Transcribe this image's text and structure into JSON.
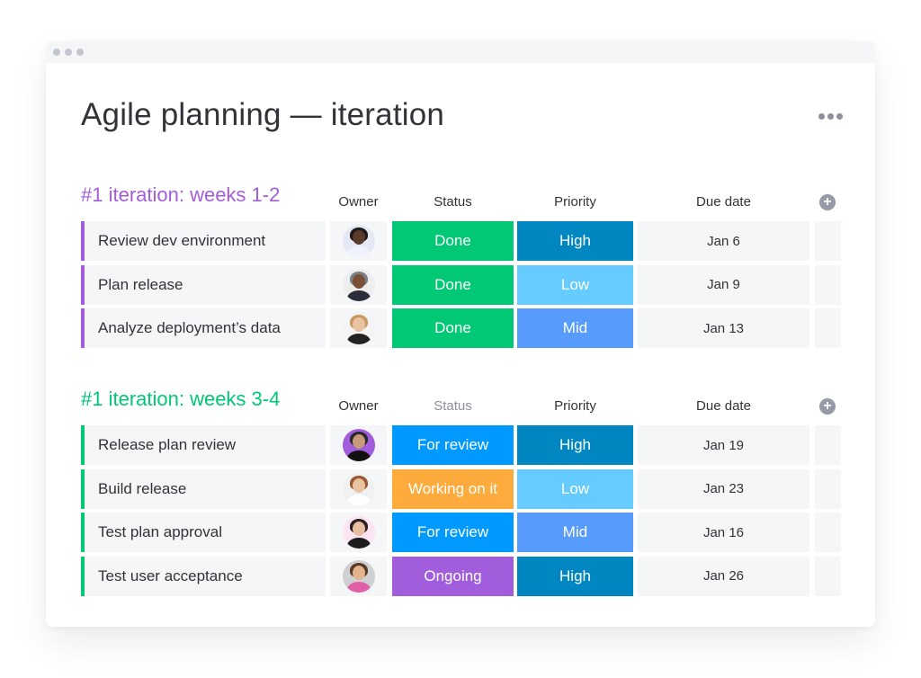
{
  "page": {
    "title": "Agile planning — iteration",
    "more_menu_icon": "more-horizontal-icon"
  },
  "columns": {
    "owner": "Owner",
    "status": "Status",
    "priority": "Priority",
    "due_date": "Due date",
    "add_column_icon": "plus-circle-icon"
  },
  "colors": {
    "group1_accent": "#a25ddc",
    "group2_accent": "#00c875",
    "status_done": "#00c875",
    "status_for_review": "#0099ff",
    "status_working": "#fdab3d",
    "status_ongoing": "#a25ddc",
    "priority_high": "#0086c0",
    "priority_low": "#66ccff",
    "priority_mid": "#579bfc"
  },
  "groups": [
    {
      "title": "#1 iteration: weeks 1-2",
      "accent": "#a25ddc",
      "status_header_muted": false,
      "rows": [
        {
          "name": "Review dev environment",
          "owner": "avatar-1",
          "status": "Done",
          "status_color": "#00c875",
          "priority": "High",
          "priority_color": "#0086c0",
          "due": "Jan 6"
        },
        {
          "name": "Plan release",
          "owner": "avatar-2",
          "status": "Done",
          "status_color": "#00c875",
          "priority": "Low",
          "priority_color": "#66ccff",
          "due": "Jan 9"
        },
        {
          "name": "Analyze deployment’s data",
          "owner": "avatar-3",
          "status": "Done",
          "status_color": "#00c875",
          "priority": "Mid",
          "priority_color": "#579bfc",
          "due": "Jan 13"
        }
      ]
    },
    {
      "title": "#1 iteration: weeks 3-4",
      "accent": "#00c875",
      "status_header_muted": true,
      "rows": [
        {
          "name": "Release plan review",
          "owner": "avatar-4",
          "status": "For review",
          "status_color": "#0099ff",
          "priority": "High",
          "priority_color": "#0086c0",
          "due": "Jan 19"
        },
        {
          "name": "Build release",
          "owner": "avatar-5",
          "status": "Working on it",
          "status_color": "#fdab3d",
          "priority": "Low",
          "priority_color": "#66ccff",
          "due": "Jan 23"
        },
        {
          "name": "Test plan approval",
          "owner": "avatar-6",
          "status": "For review",
          "status_color": "#0099ff",
          "priority": "Mid",
          "priority_color": "#579bfc",
          "due": "Jan 16"
        },
        {
          "name": "Test user acceptance",
          "owner": "avatar-7",
          "status": "Ongoing",
          "status_color": "#a25ddc",
          "priority": "High",
          "priority_color": "#0086c0",
          "due": "Jan 26"
        }
      ]
    }
  ]
}
